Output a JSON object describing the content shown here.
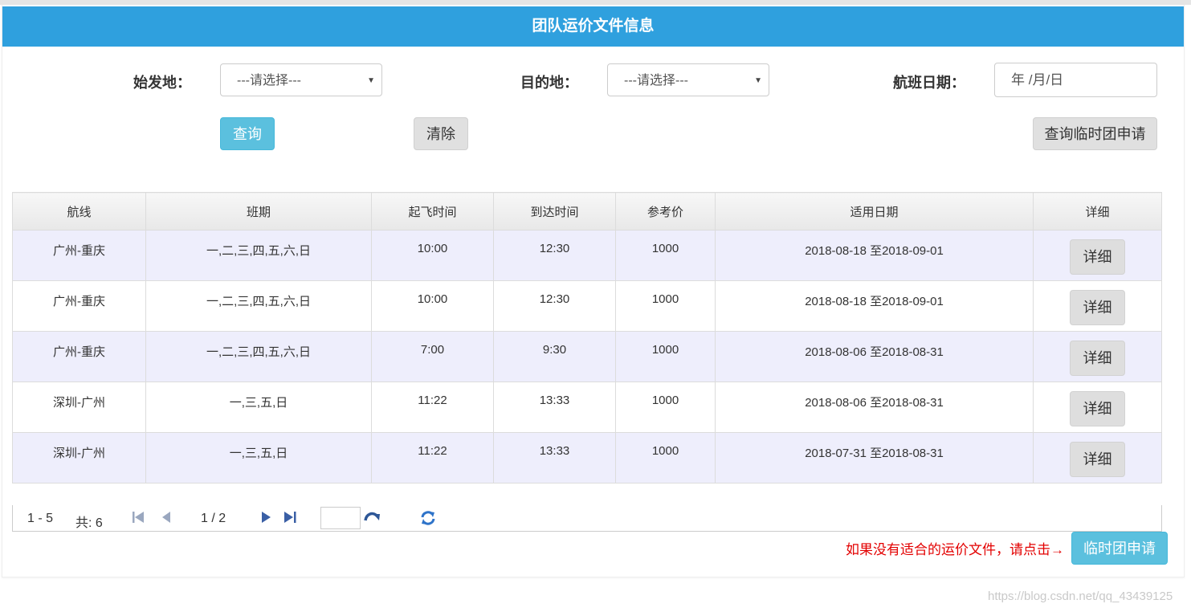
{
  "header": {
    "title": "团队运价文件信息"
  },
  "filters": {
    "origin_label": "始发地：",
    "origin_value": "---请选择---",
    "dest_label": "目的地：",
    "dest_value": "---请选择---",
    "date_label": "航班日期：",
    "date_placeholder": "年 /月/日"
  },
  "buttons": {
    "query": "查询",
    "clear": "清除",
    "query_temp": "查询临时团申请",
    "temp_apply": "临时团申请"
  },
  "table": {
    "columns": [
      "航线",
      "班期",
      "起飞时间",
      "到达时间",
      "参考价",
      "适用日期",
      "详细"
    ],
    "rows": [
      [
        "广州-重庆",
        "一,二,三,四,五,六,日",
        "10:00",
        "12:30",
        "1000",
        "2018-08-18 至2018-09-01",
        "详细"
      ],
      [
        "广州-重庆",
        "一,二,三,四,五,六,日",
        "10:00",
        "12:30",
        "1000",
        "2018-08-18 至2018-09-01",
        "详细"
      ],
      [
        "广州-重庆",
        "一,二,三,四,五,六,日",
        "7:00",
        "9:30",
        "1000",
        "2018-08-06 至2018-08-31",
        "详细"
      ],
      [
        "深圳-广州",
        "一,三,五,日",
        "11:22",
        "13:33",
        "1000",
        "2018-08-06 至2018-08-31",
        "详细"
      ],
      [
        "深圳-广州",
        "一,三,五,日",
        "11:22",
        "13:33",
        "1000",
        "2018-07-31 至2018-08-31",
        "详细"
      ]
    ]
  },
  "pager": {
    "range": "1 - 5",
    "total": "共: 6",
    "page": "1 / 2",
    "icons": [
      "first-page-icon",
      "prev-page-icon",
      "next-page-icon",
      "last-page-icon",
      "go-icon",
      "refresh-icon"
    ]
  },
  "note": "如果没有适合的运价文件，请点击→",
  "watermark": "https://blog.csdn.net/qq_43439125",
  "colors": {
    "header_bg": "#2fa0de",
    "primary_button": "#5bc0de",
    "odd_row": "#eeeefc",
    "note_text": "#e30000"
  }
}
